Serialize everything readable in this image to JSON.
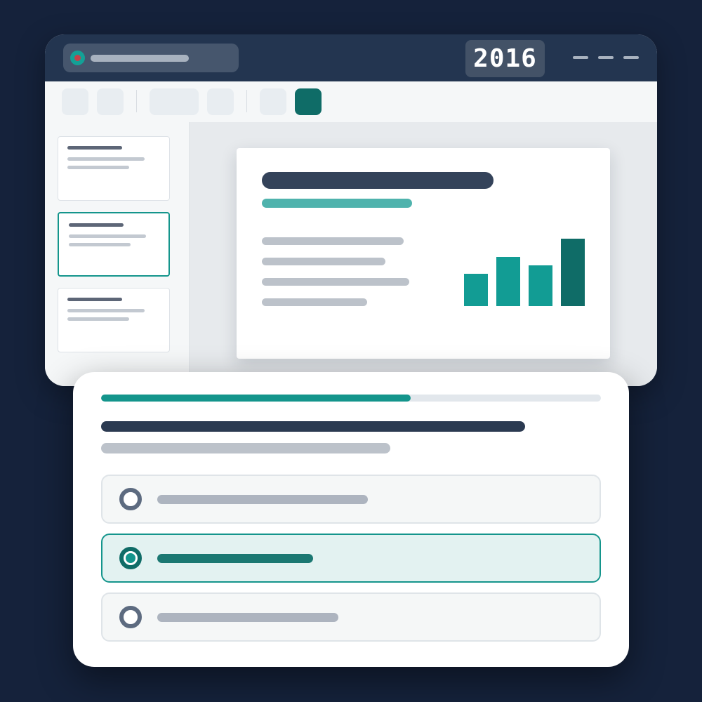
{
  "window": {
    "year_badge": "2016"
  },
  "colors": {
    "background": "#15223b",
    "titlebar": "#233550",
    "accent": "#14958c",
    "accent_dark": "#0f6c67",
    "slide_title": "#34435a"
  },
  "slide_preview": {
    "chart_data": {
      "type": "bar",
      "values": [
        46,
        70,
        58,
        96
      ],
      "ylim": [
        0,
        100
      ],
      "highlight_last": true
    }
  },
  "quiz": {
    "progress_fraction": 0.62,
    "selected_option_index": 1,
    "option_count": 3
  }
}
